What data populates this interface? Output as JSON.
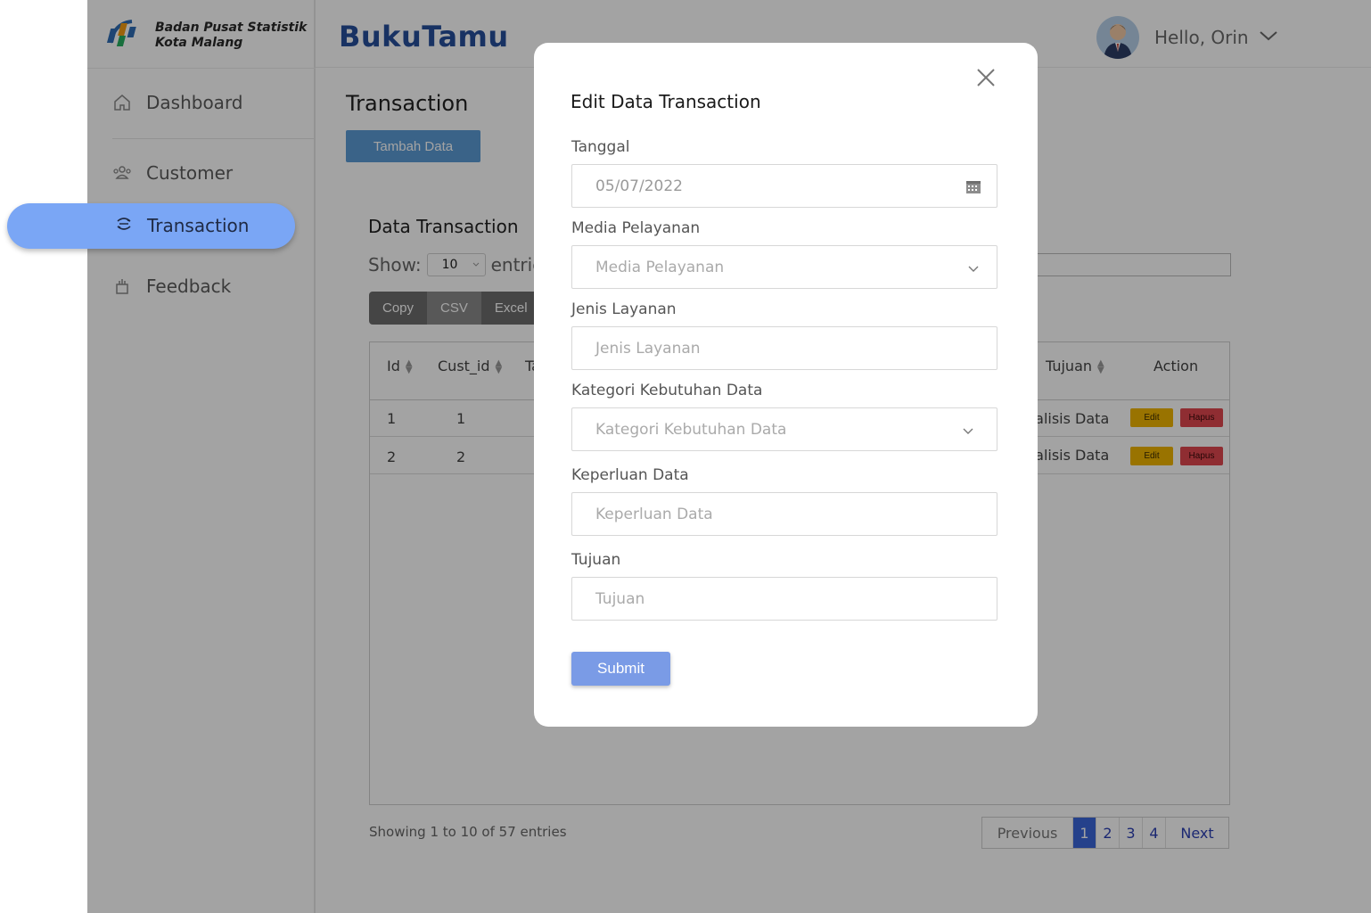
{
  "brand": {
    "line1": "Badan Pusat Statistik",
    "line2": "Kota Malang"
  },
  "app_title": "BukuTamu",
  "user": {
    "greeting": "Hello, Orin"
  },
  "sidebar": {
    "items": [
      {
        "label": "Dashboard",
        "icon": "home-icon"
      },
      {
        "label": "Customer",
        "icon": "users-icon"
      },
      {
        "label": "Transaction",
        "icon": "transaction-icon",
        "active": true
      },
      {
        "label": "Feedback",
        "icon": "feedback-icon"
      }
    ]
  },
  "main": {
    "page_title": "Transaction",
    "add_button": "Tambah Data",
    "card_title": "Data Transaction",
    "show_label": "Show:",
    "show_value": "10",
    "entries_label": "entries",
    "export_buttons": [
      "Copy",
      "CSV",
      "Excel"
    ],
    "table": {
      "headers": [
        "Id",
        "Cust_id",
        "Ta",
        "Tujuan",
        "Action"
      ],
      "rows": [
        {
          "id": "1",
          "cust_id": "1",
          "tujuan": "nalisis Data"
        },
        {
          "id": "2",
          "cust_id": "2",
          "tujuan": "nalisis Data"
        }
      ],
      "edit_label": "Edit",
      "delete_label": "Hapus"
    },
    "showing": "Showing 1 to 10 of 57 entries",
    "pager": {
      "prev": "Previous",
      "pages": [
        "1",
        "2",
        "3",
        "4"
      ],
      "current": "1",
      "next": "Next"
    }
  },
  "modal": {
    "title": "Edit Data Transaction",
    "fields": {
      "tanggal": {
        "label": "Tanggal",
        "value": "05/07/2022"
      },
      "media": {
        "label": "Media Pelayanan",
        "placeholder": "Media Pelayanan"
      },
      "jenis": {
        "label": "Jenis Layanan",
        "placeholder": "Jenis Layanan"
      },
      "kategori": {
        "label": "Kategori Kebutuhan Data",
        "placeholder": "Kategori Kebutuhan Data"
      },
      "keperluan": {
        "label": "Keperluan Data",
        "placeholder": "Keperluan Data"
      },
      "tujuan": {
        "label": "Tujuan",
        "placeholder": "Tujuan"
      }
    },
    "submit": "Submit"
  },
  "colors": {
    "brand_blue": "#274f9b",
    "active_pill": "#7aa6f5",
    "submit": "#7a9be6",
    "edit": "#f0b400",
    "hapus": "#e0474f"
  }
}
